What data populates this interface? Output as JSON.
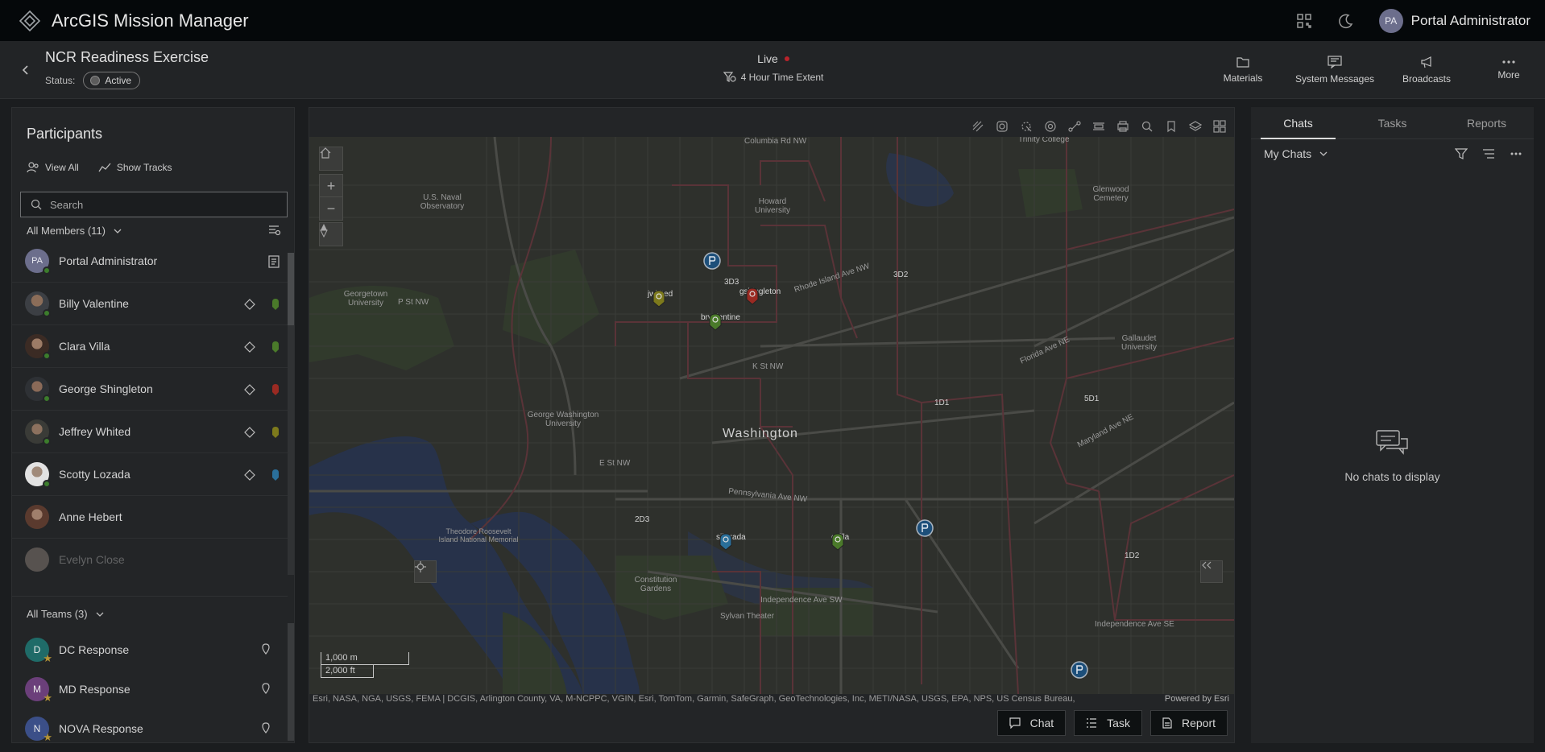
{
  "app": {
    "title": "ArcGIS Mission Manager",
    "user_initials": "PA",
    "user_name": "Portal Administrator"
  },
  "mission": {
    "title": "NCR Readiness Exercise",
    "status_label": "Status:",
    "status_value": "Active",
    "live_label": "Live",
    "time_extent": "4 Hour Time Extent"
  },
  "header_actions": [
    {
      "label": "Materials",
      "icon": "materials-icon"
    },
    {
      "label": "System Messages",
      "icon": "system-messages-icon"
    },
    {
      "label": "Broadcasts",
      "icon": "broadcast-icon"
    },
    {
      "label": "More",
      "icon": "more-icon"
    }
  ],
  "participants": {
    "title": "Participants",
    "view_all": "View All",
    "show_tracks": "Show Tracks",
    "search_placeholder": "Search",
    "members_header": "All Members (11)",
    "members": [
      {
        "name": "Portal Administrator",
        "initials": "PA",
        "marker_color": ""
      },
      {
        "name": "Billy Valentine",
        "marker_color": "#4a7a2a"
      },
      {
        "name": "Clara Villa",
        "marker_color": "#4a7a2a"
      },
      {
        "name": "George Shingleton",
        "marker_color": "#9a2a22"
      },
      {
        "name": "Jeffrey Whited",
        "marker_color": "#7d7a1c"
      },
      {
        "name": "Scotty Lozada",
        "marker_color": "#2a6f9a"
      },
      {
        "name": "Anne Hebert",
        "marker_color": ""
      },
      {
        "name": "Evelyn Close",
        "marker_color": ""
      }
    ],
    "teams_header": "All Teams (3)",
    "teams": [
      {
        "name": "DC Response",
        "initial": "D",
        "color": "#1f6b68"
      },
      {
        "name": "MD Response",
        "initial": "M",
        "color": "#6b3f7a"
      },
      {
        "name": "NOVA Response",
        "initial": "N",
        "color": "#3b4f88"
      }
    ]
  },
  "map": {
    "labels": {
      "washington": "Washington",
      "columbia_rd": "Columbia Rd NW",
      "rhode_island": "Rhode Island Ave NW",
      "florida_ave": "Florida Ave NE",
      "maryland_ave": "Maryland Ave NE",
      "pennsylvania": "Pennsylvania Ave NW",
      "independence_sw": "Independence Ave SW",
      "independence_se": "Independence Ave SE",
      "k_st": "K St NW",
      "p_st": "P St NW",
      "e_st": "E St NW",
      "georgetown": "Georgetown University",
      "gwu": "George Washington University",
      "howard": "Howard University",
      "gallaudet": "Gallaudet University",
      "naval": "U.S. Naval Observatory",
      "theodore": "Theodore Roosevelt Island National Memorial",
      "constitution": "Constitution Gardens",
      "sylvan": "Sylvan Theater",
      "glenwood": "Glenwood Cemetery",
      "trinity": "Trinity College",
      "1d1": "1D1",
      "1d2": "1D2",
      "2d3": "2D3",
      "3d2": "3D2",
      "3d3": "3D3",
      "5d1": "5D1"
    },
    "markers": [
      {
        "label": "jwhited",
        "color": "#7d7a1c"
      },
      {
        "label": "brvalentine",
        "color": "#4a7a2a"
      },
      {
        "label": "gshingleton",
        "color": "#9a2a22"
      },
      {
        "label": "sjlozada",
        "color": "#2a6f9a"
      },
      {
        "label": "cvilla",
        "color": "#4a7a2a"
      }
    ],
    "scale_metric": "1,000 m",
    "scale_imperial": "2,000 ft",
    "attribution": "Esri, NASA, NGA, USGS, FEMA | DCGIS, Arlington County, VA, M-NCPPC, VGIN, Esri, TomTom, Garmin, SafeGraph, GeoTechnologies, Inc, METI/NASA, USGS, EPA, NPS, US Census Bureau,",
    "powered_by": "Powered by Esri",
    "buttons": {
      "chat": "Chat",
      "task": "Task",
      "report": "Report"
    }
  },
  "right_panel": {
    "tabs": [
      "Chats",
      "Tasks",
      "Reports"
    ],
    "filter_label": "My Chats",
    "empty_text": "No chats to display"
  }
}
